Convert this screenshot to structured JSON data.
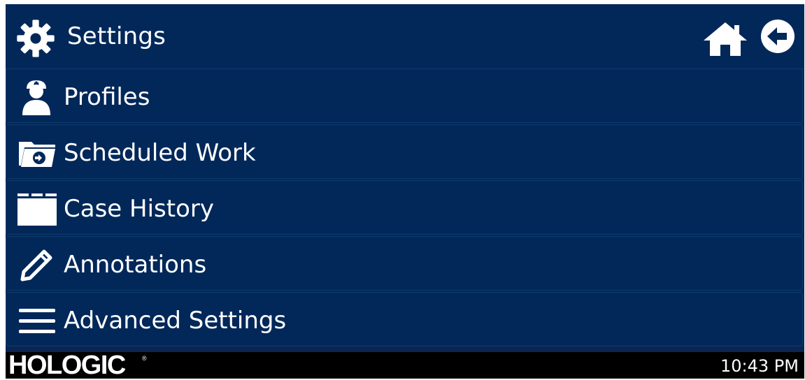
{
  "header": {
    "title": "Settings",
    "icon": "gear-icon",
    "home_icon": "home-icon",
    "back_icon": "back-arrow-icon"
  },
  "menu": {
    "items": [
      {
        "label": "Profiles",
        "icon": "user-profile-icon"
      },
      {
        "label": "Scheduled Work",
        "icon": "scheduled-folder-icon"
      },
      {
        "label": "Case History",
        "icon": "folder-icon"
      },
      {
        "label": "Annotations",
        "icon": "pencil-icon"
      },
      {
        "label": "Advanced Settings",
        "icon": "hamburger-menu-icon"
      }
    ]
  },
  "footer": {
    "logo": "HOLOGIC",
    "logo_mark": "®",
    "time": "10:43 PM"
  },
  "colors": {
    "background": "#0b2451",
    "panel": "#02285a",
    "border": "#0b3d6e",
    "footer": "#000000",
    "text": "#ffffff"
  }
}
